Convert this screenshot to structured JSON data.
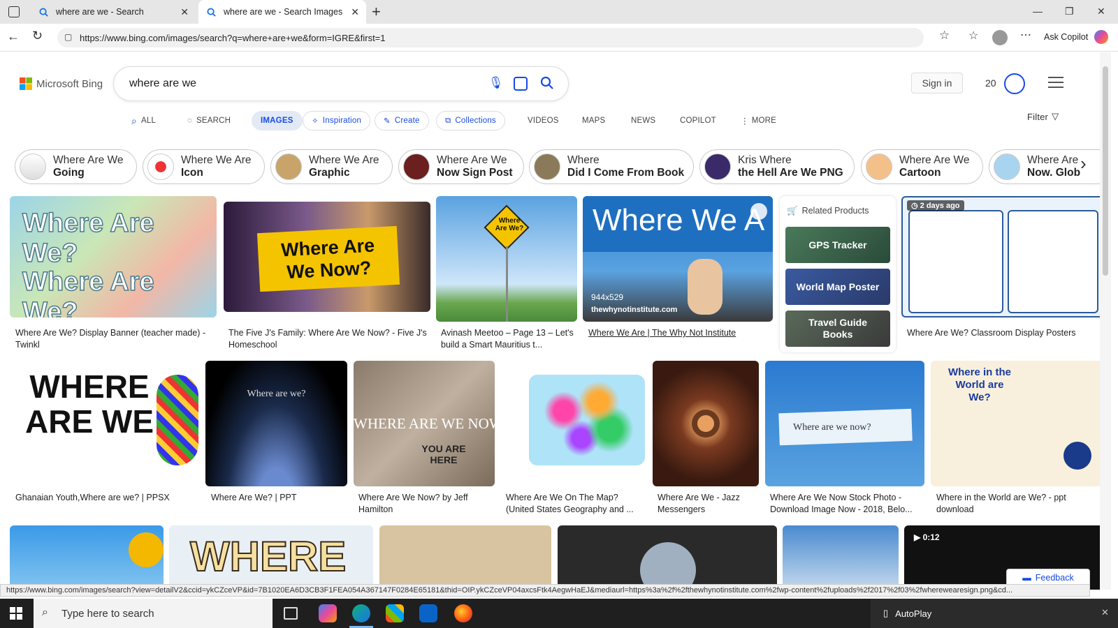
{
  "browser": {
    "tabs": [
      {
        "title": "where are we - Search"
      },
      {
        "title": "where are we - Search Images"
      }
    ],
    "url": "https://www.bing.com/images/search?q=where+are+we&form=IGRE&first=1",
    "ask_copilot": "Ask Copilot"
  },
  "header": {
    "logo_text": "Microsoft Bing",
    "query": "where are we",
    "sign_in": "Sign in",
    "rewards_count": "20"
  },
  "nav": {
    "items": [
      "ALL",
      "SEARCH",
      "IMAGES",
      "Inspiration",
      "Create",
      "Collections",
      "VIDEOS",
      "MAPS",
      "NEWS",
      "COPILOT",
      "MORE"
    ],
    "filter": "Filter"
  },
  "chips": [
    {
      "l1": "Where Are We",
      "l2": "Going"
    },
    {
      "l1": "Where We Are",
      "l2": "Icon"
    },
    {
      "l1": "Where We Are",
      "l2": "Graphic"
    },
    {
      "l1": "Where Are We",
      "l2": "Now Sign Post"
    },
    {
      "l1": "Where",
      "l2": "Did I Come From Book"
    },
    {
      "l1": "Kris Where",
      "l2": "the Hell Are We PNG"
    },
    {
      "l1": "Where Are We",
      "l2": "Cartoon"
    },
    {
      "l1": "Where Are",
      "l2": "Now. Glob"
    }
  ],
  "results_row1": {
    "img1_text": "Where Are We?",
    "img2_text": "Where Are We Now?",
    "img3_text": "Where Are We?",
    "img4_text": "Where We A",
    "img4_size": "944x529",
    "img4_source": "thewhynotinstitute.com",
    "captions": [
      "Where Are We? Display Banner (teacher made) - Twinkl",
      "The Five J's Family: Where Are We Now? - Five J's Homeschool",
      "Avinash Meetoo – Page 13 – Let's build a Smart Mauritius t...",
      "Where We Are | The Why Not Institute",
      "Where Are We? Classroom Display Posters"
    ],
    "badge": "2 days ago"
  },
  "related_products": {
    "title": "Related Products",
    "items": [
      "GPS Tracker",
      "World Map Poster",
      "Travel Guide Books"
    ]
  },
  "results_row2": {
    "img_texts": [
      "WHERE ARE WE",
      "Where are we?",
      "WHERE ARE WE NOW",
      "YOU ARE HERE",
      "Where are we now?",
      "Where in the World are We?"
    ],
    "captions": [
      "Ghanaian Youth,Where are we? | PPSX",
      "Where Are We? | PPT",
      "Where Are We Now? by Jeff Hamilton",
      "Where Are We On The Map? (United States Geography and ...",
      "Where Are We - Jazz Messengers",
      "Where Are We Now Stock Photo - Download Image Now - 2018, Belo...",
      "Where in the World are We? - ppt download"
    ]
  },
  "results_row3": {
    "img_text": "WHERE",
    "video_duration": "0:12",
    "feedback": "Feedback"
  },
  "status_url": "https://www.bing.com/images/search?view=detailV2&ccid=ykCZceVP&id=7B1020EA6D3CB3F1FEA054A367147F0284E65181&thid=OIP.ykCZceVP04axcsFtk4AegwHaEJ&mediaurl=https%3a%2f%2fthewhynotinstitute.com%2fwp-content%2fuploads%2f2017%2f03%2fwherewearesign.png&cd...",
  "taskbar": {
    "search_placeholder": "Type here to search",
    "autoplay": "AutoPlay"
  },
  "colors": {
    "accent": "#174ae4",
    "bing_blue": "#0078d4",
    "pill_bg": "#e3eaf6"
  }
}
